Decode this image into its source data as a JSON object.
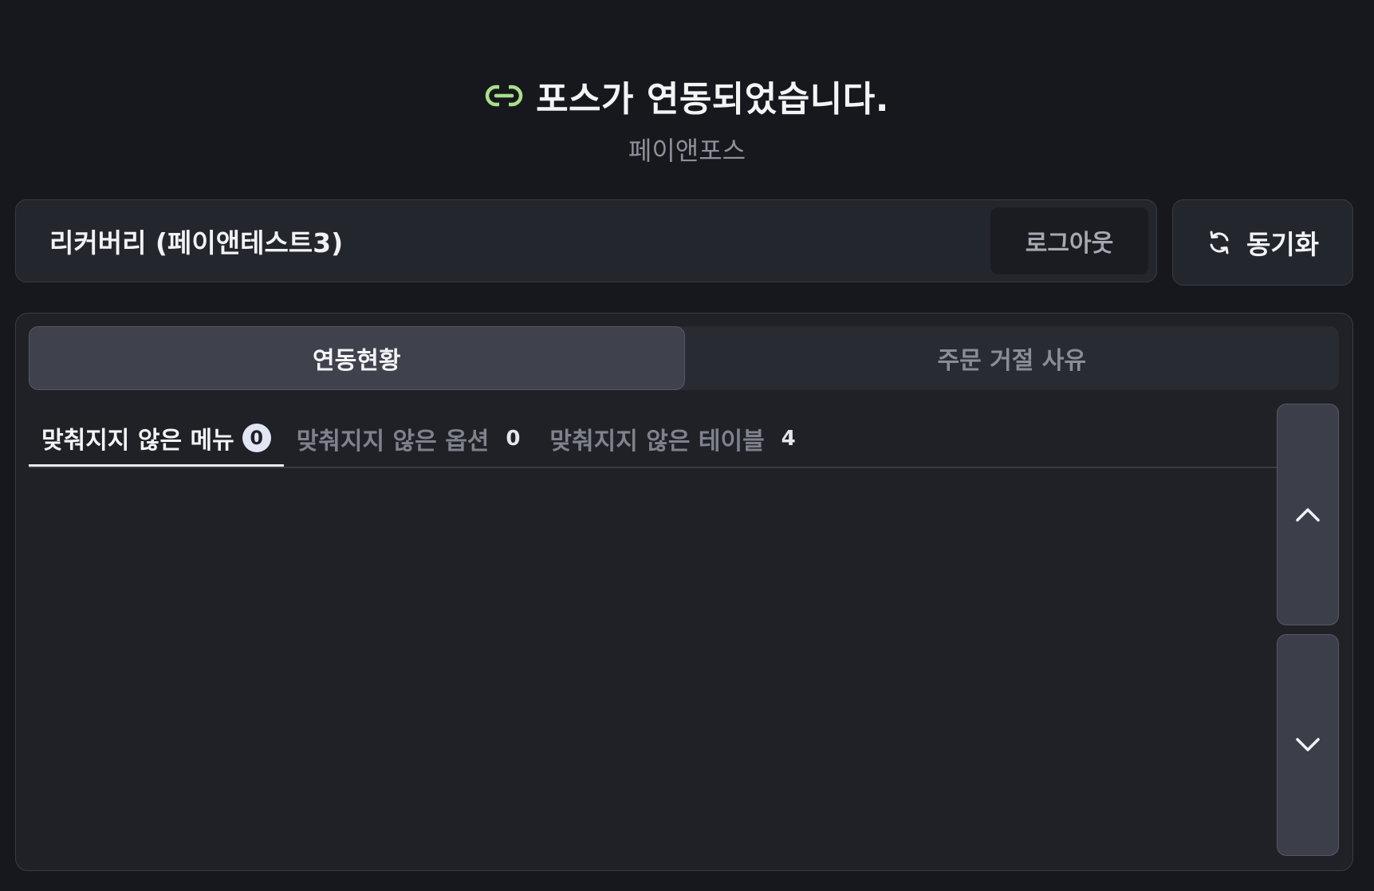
{
  "header": {
    "icon": "link-icon",
    "title": "포스가 연동되었습니다.",
    "subtitle": "페이앤포스"
  },
  "account": {
    "name": "리커버리 (페이앤테스트3)",
    "logout_label": "로그아웃",
    "sync_label": "동기화",
    "sync_icon": "refresh-icon"
  },
  "tabs": [
    {
      "label": "연동현황",
      "active": true
    },
    {
      "label": "주문 거절 사유",
      "active": false
    }
  ],
  "subtabs": [
    {
      "label": "맞춰지지 않은 메뉴",
      "count": "0",
      "active": true
    },
    {
      "label": "맞춰지지 않은 옵션",
      "count": "0",
      "active": false
    },
    {
      "label": "맞춰지지 않은 테이블",
      "count": "4",
      "active": false
    }
  ],
  "scroll": {
    "up_icon": "chevron-up-icon",
    "down_icon": "chevron-down-icon"
  },
  "colors": {
    "background": "#17181d",
    "card": "#24262d",
    "accent_link": "#a8e08a"
  }
}
